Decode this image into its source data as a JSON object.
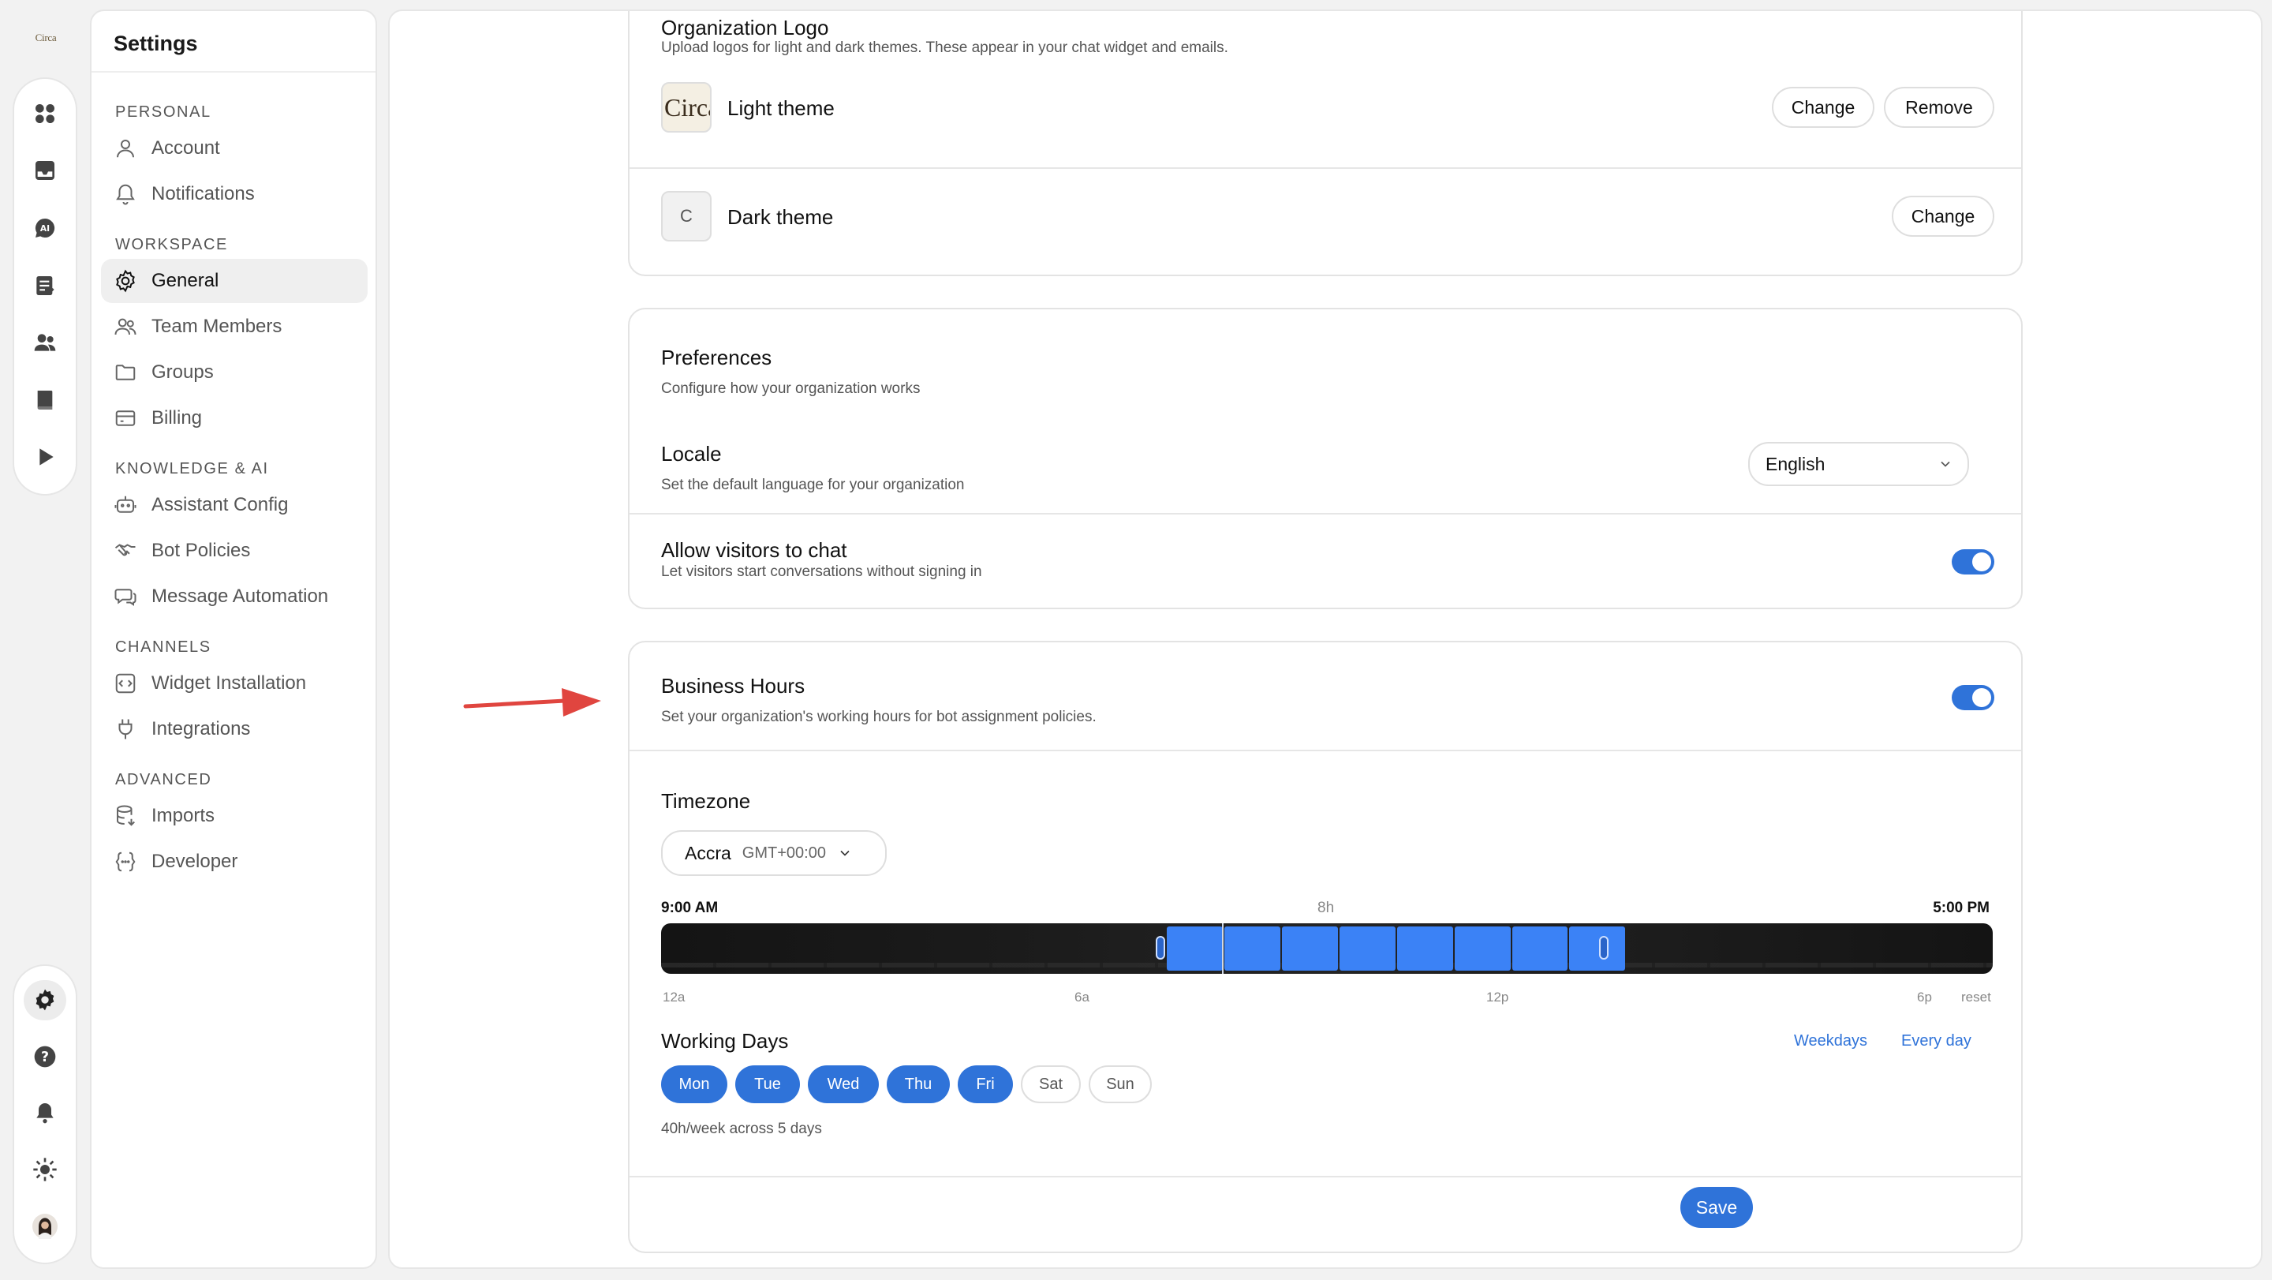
{
  "brand": {
    "logo_text": "Circa"
  },
  "rail": {
    "top_items": [
      "dashboard-icon",
      "inbox-icon",
      "ai-chat-icon",
      "tasks-icon",
      "contacts-icon",
      "knowledge-icon",
      "play-icon"
    ],
    "bottom_items": [
      "settings-icon",
      "help-icon",
      "bell-icon",
      "sun-icon",
      "avatar"
    ]
  },
  "sidebar": {
    "title": "Settings",
    "sections": [
      {
        "label": "PERSONAL",
        "items": [
          "Account",
          "Notifications"
        ]
      },
      {
        "label": "WORKSPACE",
        "items": [
          "General",
          "Team Members",
          "Groups",
          "Billing"
        ]
      },
      {
        "label": "KNOWLEDGE & AI",
        "items": [
          "Assistant Config",
          "Bot Policies",
          "Message Automation"
        ]
      },
      {
        "label": "CHANNELS",
        "items": [
          "Widget Installation",
          "Integrations"
        ]
      },
      {
        "label": "ADVANCED",
        "items": [
          "Imports",
          "Developer"
        ]
      }
    ],
    "active_item": "General"
  },
  "logo_card": {
    "title": "Organization Logo",
    "desc": "Upload logos for light and dark themes. These appear in your chat widget and emails.",
    "light": {
      "thumb": "Circa",
      "label": "Light theme",
      "change": "Change",
      "remove": "Remove"
    },
    "dark": {
      "thumb": "C",
      "label": "Dark theme",
      "change": "Change"
    }
  },
  "preferences": {
    "title": "Preferences",
    "desc": "Configure how your organization works",
    "locale": {
      "title": "Locale",
      "desc": "Set the default language for your organization",
      "value": "English"
    },
    "visitors": {
      "title": "Allow visitors to chat",
      "desc": "Let visitors start conversations without signing in",
      "enabled": true
    }
  },
  "business_hours": {
    "title": "Business Hours",
    "desc": "Set your organization's working hours for bot assignment policies.",
    "enabled": true,
    "timezone": {
      "label": "Timezone",
      "city": "Accra",
      "offset": "GMT+00:00"
    },
    "start": "9:00 AM",
    "duration": "8h",
    "end": "5:00 PM",
    "axis": [
      "12a",
      "6a",
      "12p",
      "6p"
    ],
    "reset": "reset",
    "working_days": {
      "label": "Working Days",
      "weekdays_link": "Weekdays",
      "everyday_link": "Every day",
      "days": [
        {
          "label": "Mon",
          "on": true
        },
        {
          "label": "Tue",
          "on": true
        },
        {
          "label": "Wed",
          "on": true
        },
        {
          "label": "Thu",
          "on": true
        },
        {
          "label": "Fri",
          "on": true
        },
        {
          "label": "Sat",
          "on": false
        },
        {
          "label": "Sun",
          "on": false
        }
      ],
      "summary": "40h/week across 5 days"
    },
    "save": "Save"
  },
  "colors": {
    "accent": "#2f73d9",
    "arrow": "#e0453f"
  }
}
